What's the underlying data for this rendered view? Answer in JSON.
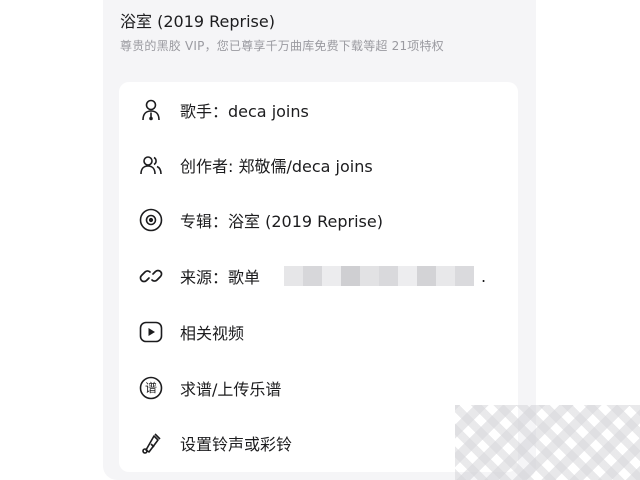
{
  "song": {
    "title": "浴室 (2019 Reprise)",
    "vip_notice": "尊贵的黑胶 VIP，您已尊享千万曲库免费下载等超 21项特权"
  },
  "menu": {
    "items": [
      {
        "id": "singer",
        "label": "歌手：deca joins",
        "icon": "singer-icon"
      },
      {
        "id": "composer",
        "label": "创作者: 郑敬儒/deca joins",
        "icon": "creators-icon"
      },
      {
        "id": "album",
        "label": "专辑：浴室 (2019 Reprise)",
        "icon": "album-disc-icon"
      },
      {
        "id": "source",
        "label": "来源：歌单",
        "icon": "link-icon",
        "suffix": "."
      },
      {
        "id": "videos",
        "label": "相关视频",
        "icon": "video-play-icon"
      },
      {
        "id": "sheet-music",
        "label": "求谱/上传乐谱",
        "icon": "sheet-music-icon",
        "icon_glyph": "谱"
      },
      {
        "id": "ringtone",
        "label": "设置铃声或彩铃",
        "icon": "ringtone-icon"
      }
    ]
  },
  "colors": {
    "sheet_bg": "#f5f5f7",
    "card_bg": "#ffffff",
    "text": "#1c1c1e",
    "subtext": "#9a9aa0"
  }
}
